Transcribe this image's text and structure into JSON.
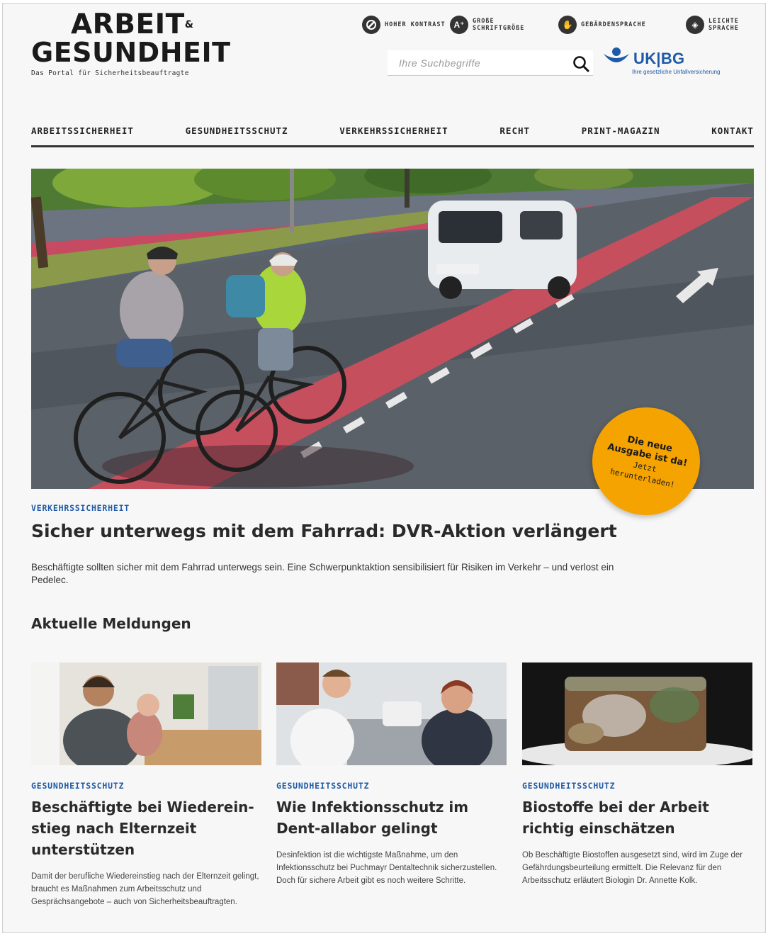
{
  "logo": {
    "line1": "ARBEIT",
    "amp": "&",
    "line2": "GESUNDHEIT",
    "sub": "Das Portal für Sicherheitsbeauftragte"
  },
  "accessibility": [
    {
      "icon": "contrast-icon",
      "glyph": "◐",
      "label": "HOHER KONTRAST"
    },
    {
      "icon": "font-size-icon",
      "glyph": "A⁺",
      "label": "GROßE SCHRIFTGRÖßE"
    },
    {
      "icon": "sign-language-icon",
      "glyph": "✋",
      "label": "GEBÄRDENSPRACHE"
    },
    {
      "icon": "easy-language-icon",
      "glyph": "◈",
      "label": "LEICHTE SPRACHE"
    }
  ],
  "search": {
    "placeholder": "Ihre Suchbegriffe"
  },
  "partner": {
    "name": "UK|BG",
    "tagline": "Ihre gesetzliche Unfallversicherung",
    "color": "#1f5aa6"
  },
  "nav": [
    "ARBEITSSICHERHEIT",
    "GESUNDHEITSSCHUTZ",
    "VERKEHRSSICHERHEIT",
    "RECHT",
    "PRINT-MAGAZIN",
    "KONTAKT"
  ],
  "hero": {
    "kicker": "VERKEHRSSICHERHEIT",
    "title": "Sicher unterwegs mit dem Fahrrad: DVR-Aktion verlängert",
    "teaser": "Beschäftigte sollten sicher mit dem Fahrrad unterwegs sein. Eine Schwerpunktaktion sensibilisiert für Risiken im Verkehr – und verlost ein Pedelec."
  },
  "badge": {
    "line1": "Die neue",
    "line2": "Ausgabe ist da!",
    "line3": "Jetzt",
    "line4": "herunterladen!",
    "color": "#f5a300"
  },
  "section": {
    "title": "Aktuelle Meldungen"
  },
  "cards": [
    {
      "kicker": "GESUNDHEITSSCHUTZ",
      "title": "Beschäftigte bei Wiederein-stieg nach Elternzeit unterstützen",
      "teaser": "Damit der berufliche Wiedereinstieg nach der Elternzeit gelingt, braucht es Maßnahmen zum Arbeitsschutz und Gesprächsangebote – auch von Sicherheitsbeauftragten."
    },
    {
      "kicker": "GESUNDHEITSSCHUTZ",
      "title": "Wie Infektionsschutz im Dent-allabor gelingt",
      "teaser": "Desinfektion ist die wichtigste Maßnahme, um den Infektionsschutz bei Puchmayr Dentaltechnik sicherzustellen. Doch für sichere Arbeit gibt es noch weitere Schritte."
    },
    {
      "kicker": "GESUNDHEITSSCHUTZ",
      "title": "Biostoffe bei der Arbeit richtig einschätzen",
      "teaser": "Ob Beschäftigte Biostoffen ausgesetzt sind, wird im Zuge der Gefährdungsbeurteilung ermittelt. Die Relevanz für den Arbeitsschutz erläutert Biologin Dr. Annette Kolk."
    }
  ],
  "colors": {
    "accent": "#1f5aa6",
    "text": "#2a2a2a",
    "background": "#f7f7f7"
  }
}
